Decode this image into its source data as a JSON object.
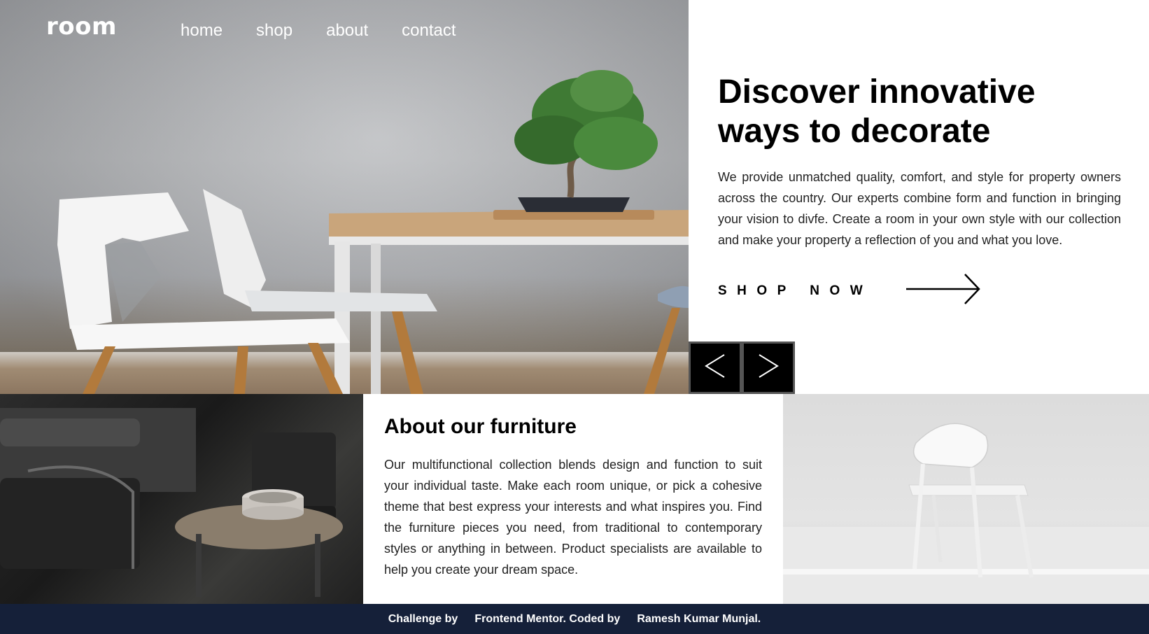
{
  "header": {
    "logo": "room",
    "nav": [
      {
        "label": "home"
      },
      {
        "label": "shop"
      },
      {
        "label": "about"
      },
      {
        "label": "contact"
      }
    ]
  },
  "hero": {
    "title_line1": "Discover innovative",
    "title_line2": "ways to decorate",
    "description": "We provide unmatched quality, comfort, and style for property owners across the country. Our experts combine form and function in bringing your vision to divfe. Create a room in your own style with our collection and make your property a reflection of you and what you love.",
    "cta_label": "SHOP NOW",
    "cta_icon": "arrow-right-icon"
  },
  "slider": {
    "prev_icon": "chevron-left-icon",
    "next_icon": "chevron-right-icon"
  },
  "about": {
    "title": "About our furniture",
    "description": "Our multifunctional collection blends design and function to suit your individual taste. Make each room unique, or pick a cohesive theme that best express your interests and what inspires you. Find the furniture pieces you need, from traditional to contemporary styles or anything in between. Product specialists are available to help you create your dream space."
  },
  "footer": {
    "part1": "Challenge by",
    "part2": "Frontend Mentor. Coded by",
    "part3": "Ramesh Kumar Munjal."
  },
  "colors": {
    "footer_bg": "#152039",
    "slider_bg": "#000000"
  }
}
